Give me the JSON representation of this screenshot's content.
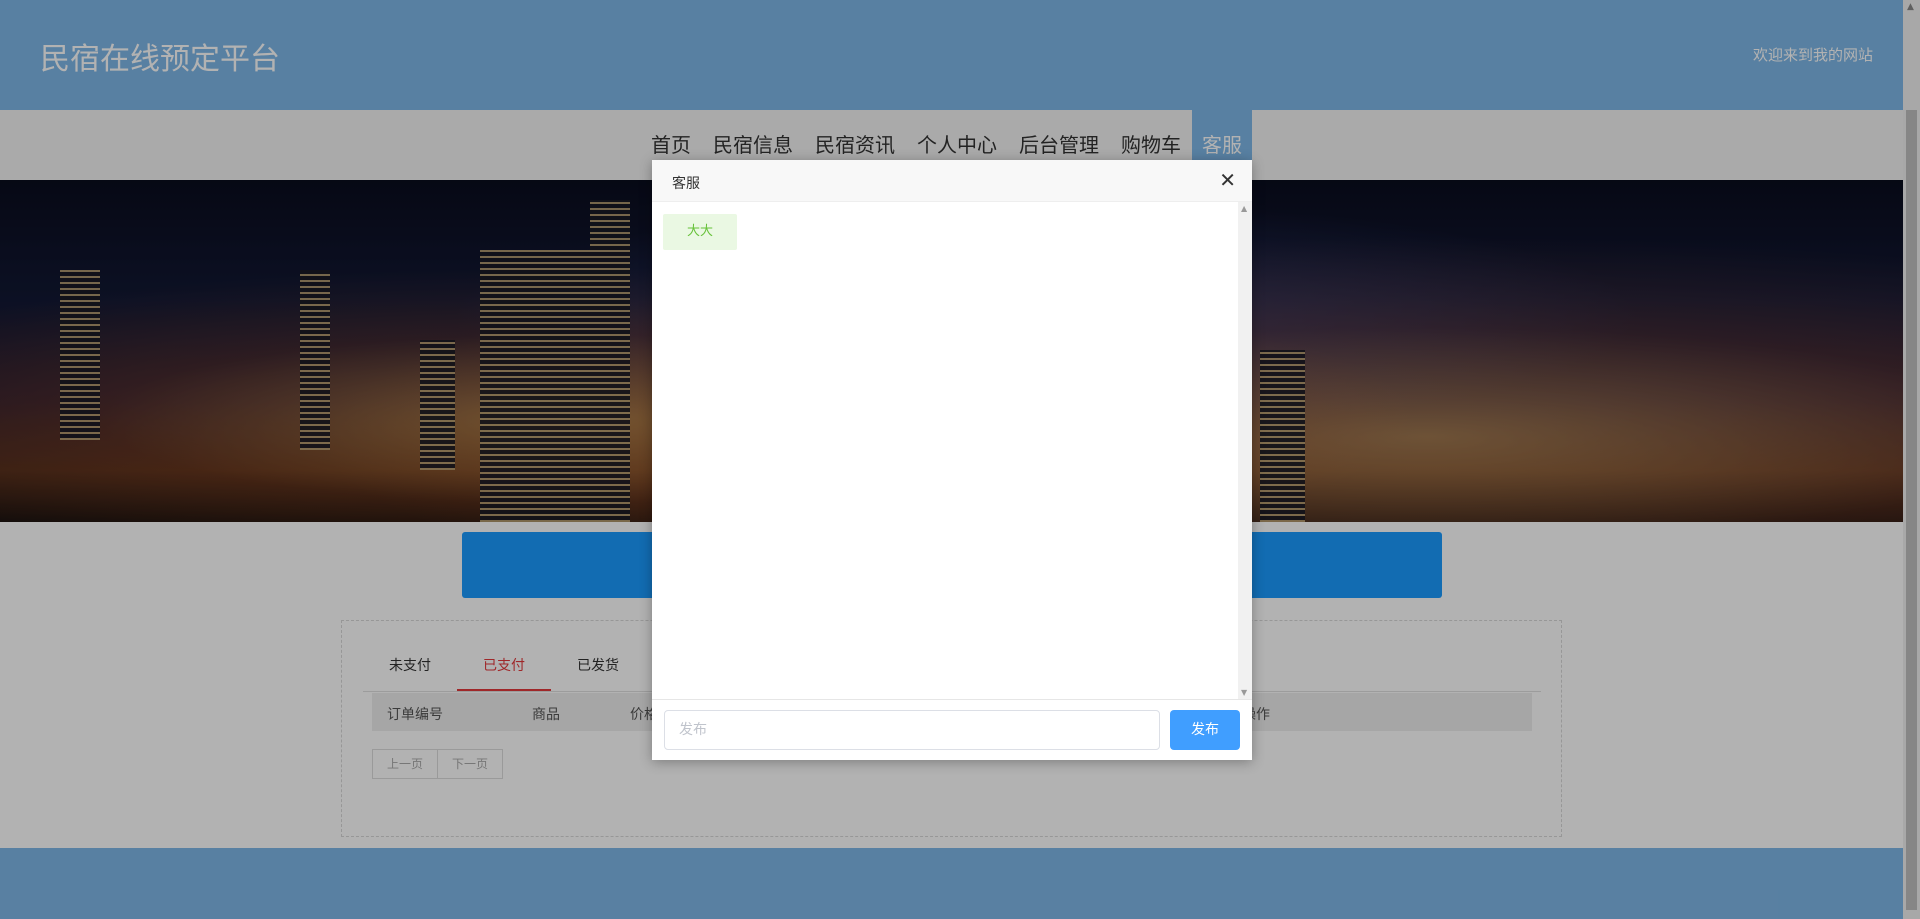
{
  "header": {
    "site_title": "民宿在线预定平台",
    "welcome": "欢迎来到我的网站"
  },
  "nav": {
    "items": [
      {
        "label": "首页"
      },
      {
        "label": "民宿信息"
      },
      {
        "label": "民宿资讯"
      },
      {
        "label": "个人中心"
      },
      {
        "label": "后台管理"
      },
      {
        "label": "购物车"
      },
      {
        "label": "客服",
        "active": true
      }
    ]
  },
  "orders": {
    "tabs": [
      {
        "label": "未支付"
      },
      {
        "label": "已支付",
        "active": true
      },
      {
        "label": "已发货"
      }
    ],
    "columns": [
      "订单编号",
      "商品",
      "价格",
      "操作"
    ],
    "pager": {
      "prev": "上一页",
      "next": "下一页"
    }
  },
  "modal": {
    "title": "客服",
    "messages": [
      {
        "text": "大大"
      }
    ],
    "input_placeholder": "发布",
    "send_label": "发布"
  },
  "colors": {
    "header_bg": "#7fb8e8",
    "accent_blue": "#1a9bff",
    "tab_active": "#e4393c",
    "send_button": "#409eff",
    "bubble_bg": "#eaf8e3",
    "bubble_text": "#67c23a"
  }
}
